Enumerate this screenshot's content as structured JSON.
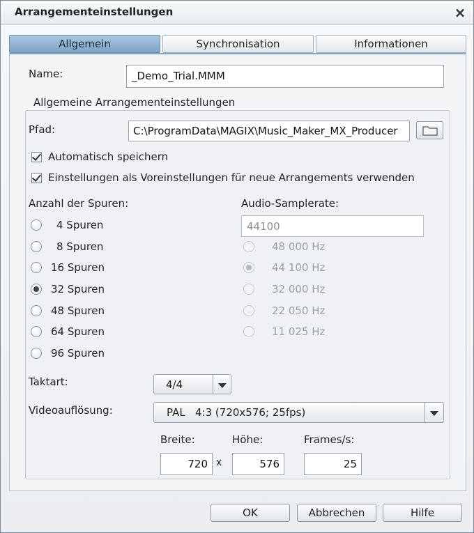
{
  "window": {
    "title": "Arrangementeinstellungen",
    "close_glyph": "×"
  },
  "tabs": [
    {
      "label": "Allgemein",
      "active": true
    },
    {
      "label": "Synchronisation",
      "active": false
    },
    {
      "label": "Informationen",
      "active": false
    }
  ],
  "name": {
    "label": "Name:",
    "value": "_Demo_Trial.MMM"
  },
  "general_group": {
    "title": "Allgemeine Arrangementeinstellungen",
    "path_label": "Pfad:",
    "path_value": "C:\\ProgramData\\MAGIX\\Music_Maker_MX_Producer",
    "autosave": {
      "label": "Automatisch speichern",
      "checked": true
    },
    "use_defaults": {
      "label": "Einstellungen als Voreinstellungen für neue Arrangements verwenden",
      "checked": true
    }
  },
  "tracks": {
    "label": "Anzahl der Spuren:",
    "selected": "32 Spuren",
    "options": [
      "4 Spuren",
      "8 Spuren",
      "16 Spuren",
      "32 Spuren",
      "48 Spuren",
      "64 Spuren",
      "96 Spuren"
    ]
  },
  "samplerate": {
    "label": "Audio-Samplerate:",
    "value": "44100",
    "selected": "44 100 Hz",
    "options": [
      "48 000 Hz",
      "44 100 Hz",
      "32 000 Hz",
      "22 050 Hz",
      "11 025 Hz"
    ]
  },
  "time_signature": {
    "label": "Taktart:",
    "value": "4/4"
  },
  "video": {
    "label": "Videoauflösung:",
    "value": "PAL   4:3 (720x576; 25fps)",
    "width_label": "Breite:",
    "width_value": "720",
    "times": "x",
    "height_label": "Höhe:",
    "height_value": "576",
    "fps_label": "Frames/s:",
    "fps_value": "25"
  },
  "buttons": {
    "ok": "OK",
    "cancel": "Abbrechen",
    "help": "Hilfe"
  },
  "colors": {
    "active_tab": "#8fb2d1",
    "disabled_text": "#9aa1a8"
  }
}
